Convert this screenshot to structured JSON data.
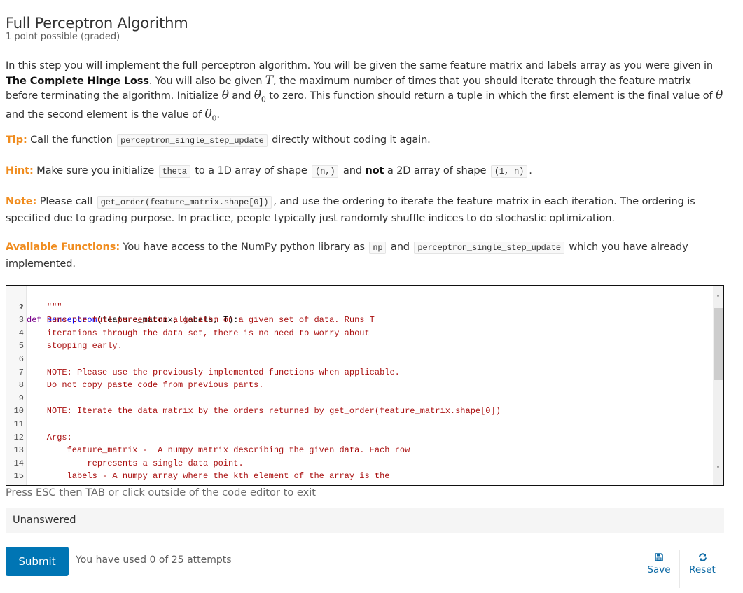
{
  "problem": {
    "title": "Full Perceptron Algorithm",
    "points": "1 point possible (graded)"
  },
  "intro": {
    "t1": "In this step you will implement the full perceptron algorithm. You will be given the same feature matrix and labels array as you were given in ",
    "b1": "The Complete Hinge Loss",
    "t2": ". You will also be given ",
    "m_T": "T",
    "t3": ", the maximum number of times that you should iterate through the feature matrix before terminating the algorithm. Initialize ",
    "m_theta": "θ",
    "t4": " and ",
    "m_theta0": "θ",
    "m_sub0": "0",
    "t5": " to zero. This function should return a tuple in which the first element is the final value of ",
    "m_theta_b": "θ",
    "t6": " and the second element is the value of ",
    "m_theta0_b": "θ",
    "m_sub0_b": "0",
    "t7": "."
  },
  "tip": {
    "label": "Tip:",
    "t1": " Call the function ",
    "code1": "perceptron_single_step_update",
    "t2": " directly without coding it again."
  },
  "hint": {
    "label": "Hint:",
    "t1": " Make sure you initialize ",
    "code1": "theta",
    "t2": " to a 1D array of shape ",
    "code2": "(n,)",
    "t3": " and ",
    "b1": "not",
    "t4": " a 2D array of shape ",
    "code3": "(1, n)",
    "t5": "."
  },
  "note": {
    "label": "Note:",
    "t1": " Please call ",
    "code1": "get_order(feature_matrix.shape[0])",
    "t2": ", and use the ordering to iterate the feature matrix in each iteration. The ordering is specified due to grading purpose. In practice, people typically just randomly shuffle indices to do stochastic optimization."
  },
  "available": {
    "label": "Available Functions:",
    "t1": " You have access to the NumPy python library as ",
    "code1": "np",
    "t2": " and ",
    "code2": "perceptron_single_step_update",
    "t3": " which you have already implemented."
  },
  "editor": {
    "line1": {
      "num": "1",
      "kw": "def",
      "fn": "perceptron",
      "rest": "(feature_matrix, labels, T):"
    },
    "lines": [
      {
        "num": "2",
        "text": "    \"\"\""
      },
      {
        "num": "3",
        "text": "    Runs the full perceptron algorithm on a given set of data. Runs T"
      },
      {
        "num": "4",
        "text": "    iterations through the data set, there is no need to worry about"
      },
      {
        "num": "5",
        "text": "    stopping early."
      },
      {
        "num": "6",
        "text": ""
      },
      {
        "num": "7",
        "text": "    NOTE: Please use the previously implemented functions when applicable."
      },
      {
        "num": "8",
        "text": "    Do not copy paste code from previous parts."
      },
      {
        "num": "9",
        "text": ""
      },
      {
        "num": "10",
        "text": "    NOTE: Iterate the data matrix by the orders returned by get_order(feature_matrix.shape[0])"
      },
      {
        "num": "11",
        "text": ""
      },
      {
        "num": "12",
        "text": "    Args:"
      },
      {
        "num": "13",
        "text": "        feature_matrix -  A numpy matrix describing the given data. Each row"
      },
      {
        "num": "14",
        "text": "            represents a single data point."
      },
      {
        "num": "15",
        "text": "        labels - A numpy array where the kth element of the array is the"
      }
    ],
    "scroll_up_icon": "˄",
    "scroll_down_icon": "˅"
  },
  "esc_hint": "Press ESC then TAB or click outside of the code editor to exit",
  "status": "Unanswered",
  "actions": {
    "submit": "Submit",
    "attempts": "You have used 0 of 25 attempts",
    "save": "Save",
    "reset": "Reset"
  },
  "colors": {
    "accent": "#0075b4",
    "label_orange": "#f08c1e",
    "code_string": "#aa1111",
    "code_keyword": "#770088",
    "code_function": "#0000ff"
  }
}
